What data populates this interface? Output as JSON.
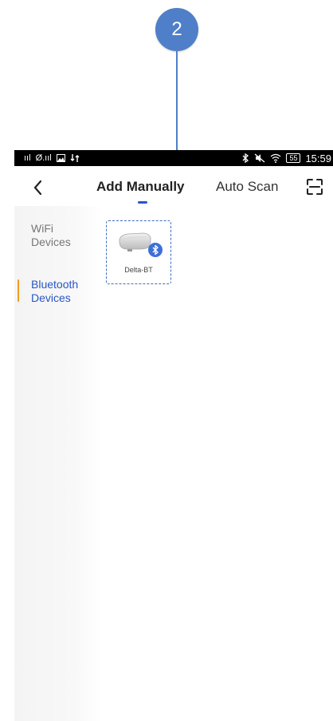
{
  "callout": {
    "number": "2"
  },
  "status_bar": {
    "signal_left": "ııl",
    "signal_mid": "Ø.ııl",
    "battery": "55",
    "time": "15:59"
  },
  "nav": {
    "tab_manual": "Add Manually",
    "tab_scan": "Auto Scan"
  },
  "sidebar": {
    "items": [
      {
        "label": "WiFi Devices",
        "active": false
      },
      {
        "label": "Bluetooth Devices",
        "active": true
      }
    ]
  },
  "devices": [
    {
      "name": "Delta-BT",
      "icon": "bluetooth-icon"
    }
  ],
  "colors": {
    "accent": "#2a55c8",
    "indicator": "#f39a22",
    "callout": "#4f7fc9"
  }
}
